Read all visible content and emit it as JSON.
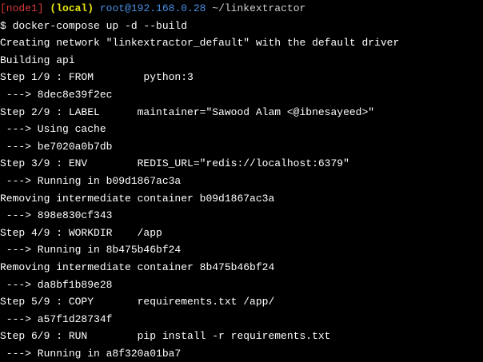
{
  "prompt": {
    "node": "[node1]",
    "env": "(local)",
    "userhost": "root@192.168.0.28",
    "path": "~/linkextractor"
  },
  "lines": [
    "$ docker-compose up -d --build",
    "Creating network \"linkextractor_default\" with the default driver",
    "Building api",
    "Step 1/9 : FROM        python:3",
    " ---> 8dec8e39f2ec",
    "Step 2/9 : LABEL      maintainer=\"Sawood Alam <@ibnesayeed>\"",
    " ---> Using cache",
    " ---> be7020a0b7db",
    "Step 3/9 : ENV        REDIS_URL=\"redis://localhost:6379\"",
    " ---> Running in b09d1867ac3a",
    "Removing intermediate container b09d1867ac3a",
    " ---> 898e830cf343",
    "Step 4/9 : WORKDIR    /app",
    " ---> Running in 8b475b46bf24",
    "Removing intermediate container 8b475b46bf24",
    " ---> da8bf1b89e28",
    "Step 5/9 : COPY       requirements.txt /app/",
    " ---> a57f1d28734f",
    "Step 6/9 : RUN        pip install -r requirements.txt",
    " ---> Running in a8f320a01ba7"
  ],
  "colors": {
    "background": "#000000",
    "text": "#ffffff",
    "node": "#d83b3b",
    "env": "#e5e510",
    "userhost": "#4a90e2"
  }
}
